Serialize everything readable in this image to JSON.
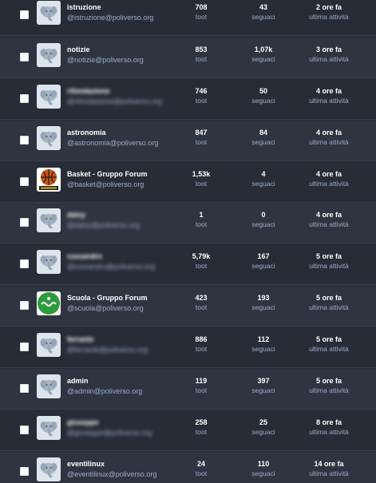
{
  "labels": {
    "toot": "toot",
    "followers": "seguaci",
    "last_active": "ultima attività"
  },
  "accounts": [
    {
      "name": "istruzione",
      "handle": "@istruzione@poliverso.org",
      "toots": "708",
      "followers": "43",
      "last": "2 ore fa",
      "avatar": "elephant",
      "blur_name": false,
      "blur_handle": false
    },
    {
      "name": "notizie",
      "handle": "@notizie@poliverso.org",
      "toots": "853",
      "followers": "1,07k",
      "last": "3 ore fa",
      "avatar": "elephant",
      "blur_name": false,
      "blur_handle": false
    },
    {
      "name": "rifondazione",
      "handle": "@rifondazione@poliverso.org",
      "toots": "746",
      "followers": "50",
      "last": "4 ore fa",
      "avatar": "elephant",
      "blur_name": true,
      "blur_handle": true
    },
    {
      "name": "astronomia",
      "handle": "@astronomia@poliverso.org",
      "toots": "847",
      "followers": "84",
      "last": "4 ore fa",
      "avatar": "elephant",
      "blur_name": false,
      "blur_handle": false
    },
    {
      "name": "Basket - Gruppo Forum",
      "handle": "@basket@poliverso.org",
      "toots": "1,53k",
      "followers": "4",
      "last": "4 ore fa",
      "avatar": "basket",
      "blur_name": false,
      "blur_handle": false
    },
    {
      "name": "daisy",
      "handle": "@daisy@poliverso.org",
      "toots": "1",
      "followers": "0",
      "last": "4 ore fa",
      "avatar": "elephant",
      "blur_name": true,
      "blur_handle": true
    },
    {
      "name": "russandro",
      "handle": "@russandro@poliverso.org",
      "toots": "5,79k",
      "followers": "167",
      "last": "5 ore fa",
      "avatar": "elephant",
      "blur_name": true,
      "blur_handle": true
    },
    {
      "name": "Scuola - Gruppo Forum",
      "handle": "@scuola@poliverso.org",
      "toots": "423",
      "followers": "193",
      "last": "5 ore fa",
      "avatar": "scuola",
      "blur_name": false,
      "blur_handle": false
    },
    {
      "name": "ferrante",
      "handle": "@ferrante@poliverso.org",
      "toots": "886",
      "followers": "112",
      "last": "5 ore fa",
      "avatar": "elephant",
      "blur_name": true,
      "blur_handle": true
    },
    {
      "name": "admin",
      "handle": "@admin@poliverso.org",
      "toots": "119",
      "followers": "397",
      "last": "5 ore fa",
      "avatar": "elephant",
      "blur_name": false,
      "blur_handle": false
    },
    {
      "name": "giuseppe",
      "handle": "@giuseppe@poliverso.org",
      "toots": "258",
      "followers": "25",
      "last": "8 ore fa",
      "avatar": "elephant",
      "blur_name": true,
      "blur_handle": true
    },
    {
      "name": "eventilinux",
      "handle": "@eventilinux@poliverso.org",
      "toots": "24",
      "followers": "110",
      "last": "14 ore fa",
      "avatar": "elephant",
      "blur_name": false,
      "blur_handle": false
    }
  ]
}
